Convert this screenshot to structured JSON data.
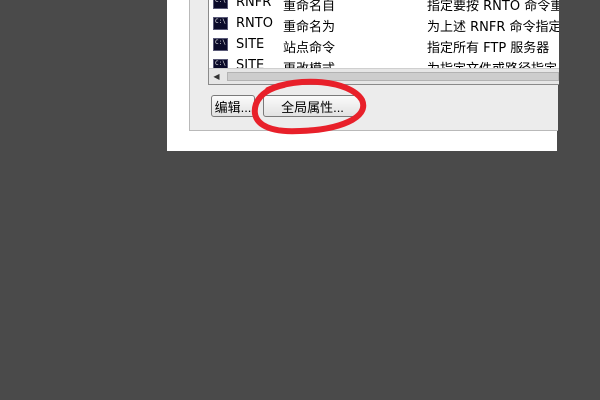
{
  "list": {
    "rows": [
      {
        "icon": "command-prompt-icon",
        "icon_text": "C:\\",
        "command": "RNFR",
        "name": "重命名自",
        "description": "指定要按 RNTO 命令重"
      },
      {
        "icon": "command-prompt-icon",
        "icon_text": "C:\\",
        "command": "RNTO",
        "name": "重命名为",
        "description": "为上述 RNFR 命令指定"
      },
      {
        "icon": "command-prompt-icon",
        "icon_text": "C:\\",
        "command": "SITE",
        "name": "站点命令",
        "description": "指定所有 FTP 服务器"
      },
      {
        "icon": "command-prompt-icon",
        "icon_text": "C:\\",
        "command": "SITE",
        "name": "更改模式",
        "description": "为指定文件或路径指定"
      }
    ],
    "scrollbar": {
      "left_arrow": "◀"
    }
  },
  "buttons": {
    "edit_label": "编辑...",
    "global_properties_label": "全局属性..."
  },
  "colors": {
    "background": "#4a4a4a",
    "annotation": "#e8202a"
  }
}
